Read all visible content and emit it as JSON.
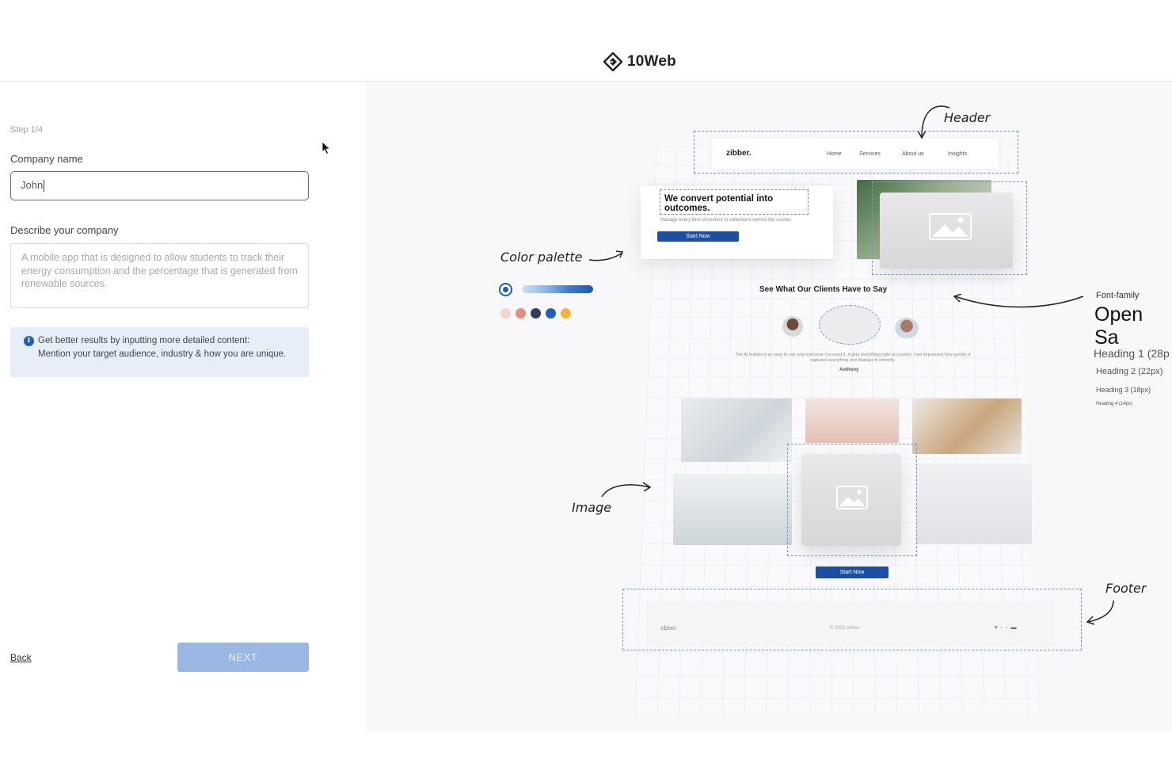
{
  "header": {
    "logo_text": "10Web"
  },
  "form": {
    "step": "Step 1/4",
    "company_label": "Company name",
    "company_value": "John",
    "desc_label": "Describe your company",
    "desc_placeholder": "A mobile app that is designed to allow students to track their energy consumption and the percentage that is generated from renewable sources.",
    "tip_title": "Get better results by inputting more detailed content:",
    "tip_body": "Mention your target audience, industry & how you are unique.",
    "back_label": "Back",
    "next_label": "NEXT"
  },
  "preview": {
    "annotations": {
      "header": "Header",
      "color_palette": "Color palette",
      "image": "Image",
      "footer": "Footer",
      "font_family": "Font-family"
    },
    "site": {
      "brand": "zibber.",
      "nav": [
        "Home",
        "Services",
        "About us",
        "Insights"
      ],
      "hero_title": "We convert potential into outcomes.",
      "hero_sub": "Manage every kind of content in collections behind the scenes",
      "hero_button": "Start Now",
      "testimonial_title": "See What Our Clients Have to Say",
      "testimonial_text": "The AI builder is so easy to use and everyone I've used it, it gets everything right accurately. I am impressed how quickly it captures everything and displays it correctly.",
      "testimonial_name": "Anthony",
      "cta_button": "Start Now",
      "footer_brand": "zibber.",
      "footer_copy": "© 2022 zibber"
    },
    "fonts": {
      "family": "Open Sa",
      "h1": "Heading 1 (28p",
      "h2": "Heading 2 (22px)",
      "h3": "Heading 3 (18px)",
      "h4": "Heading 4 (14px)"
    },
    "palette": [
      "#f6d6c8",
      "#ee8a7c",
      "#2c3e5a",
      "#1b62b8",
      "#f4b43c"
    ]
  },
  "icons": {
    "logo": "10web-diamond-icon",
    "info": "info-icon",
    "cursor": "mouse-pointer-icon",
    "image_placeholder": "image-placeholder-icon",
    "check": "radio-check-icon"
  }
}
